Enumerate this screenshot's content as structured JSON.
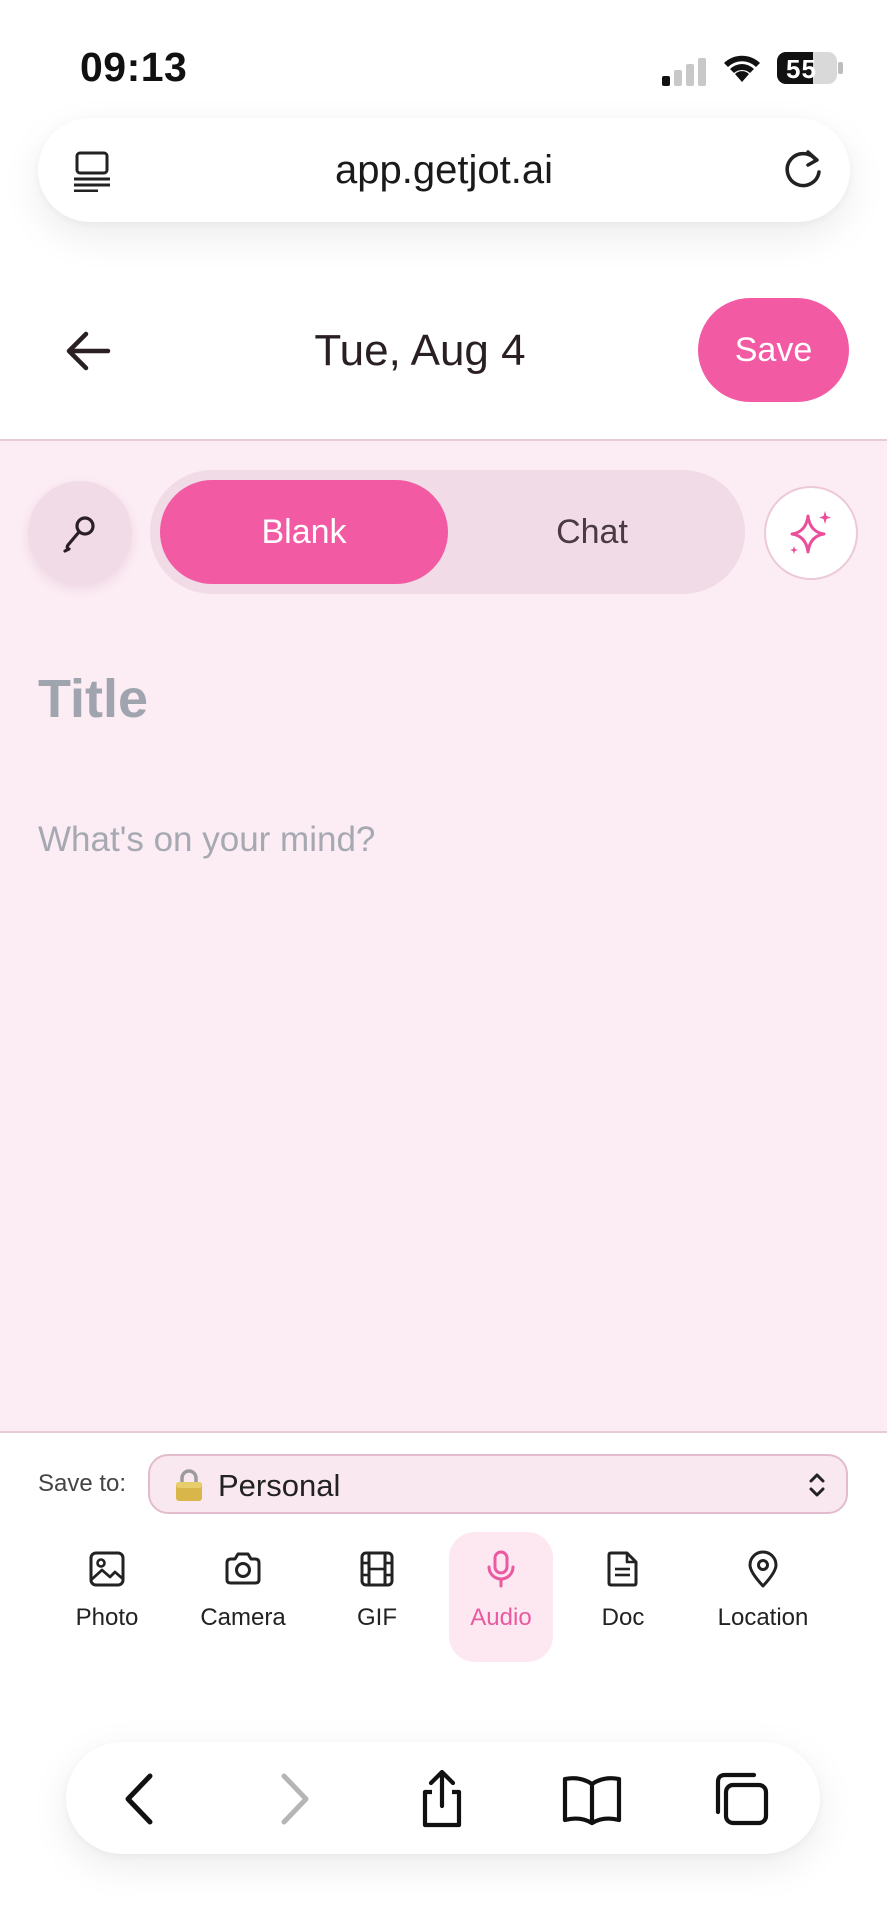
{
  "status_bar": {
    "time": "09:13",
    "battery": "55"
  },
  "browser": {
    "url": "app.getjot.ai"
  },
  "header": {
    "date": "Tue, Aug 4",
    "save_label": "Save"
  },
  "editor": {
    "modes": [
      {
        "label": "Blank",
        "selected": true
      },
      {
        "label": "Chat",
        "selected": false
      }
    ],
    "title_placeholder": "Title",
    "body_placeholder": "What's on your mind?"
  },
  "save_to": {
    "label": "Save to:",
    "folder": "Personal"
  },
  "attachments": [
    {
      "label": "Photo",
      "icon": "photo-icon"
    },
    {
      "label": "Camera",
      "icon": "camera-icon"
    },
    {
      "label": "GIF",
      "icon": "film-icon"
    },
    {
      "label": "Audio",
      "icon": "microphone-icon",
      "active": true
    },
    {
      "label": "Doc",
      "icon": "document-icon"
    },
    {
      "label": "Location",
      "icon": "location-pin-icon"
    }
  ],
  "colors": {
    "accent": "#f25aa4",
    "editor_bg": "#fcecf4",
    "toggle_bg": "#f0dbe6"
  }
}
